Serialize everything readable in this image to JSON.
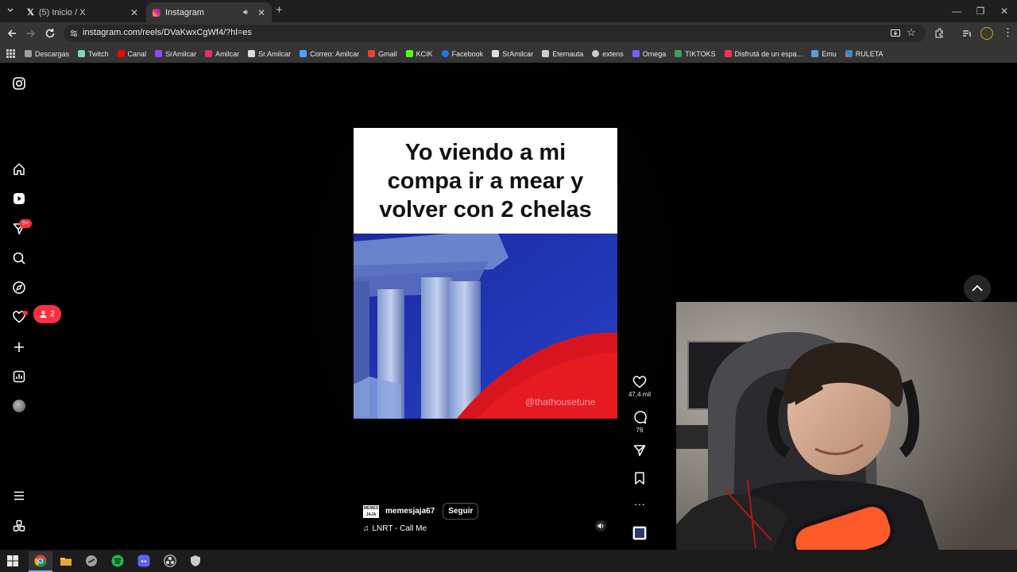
{
  "browser": {
    "tabs": [
      {
        "title": "(5) Inicio / X",
        "active": false,
        "icon": "x-logo-icon"
      },
      {
        "title": "Instagram",
        "active": true,
        "icon": "instagram-icon"
      }
    ],
    "url": "instagram.com/reels/DVaKwxCgWf4/?hl=es",
    "bookmarks": [
      {
        "label": "Descargas",
        "color": "#9aa0a6"
      },
      {
        "label": "Twitch",
        "color": "#7dd3c0"
      },
      {
        "label": "Canal",
        "color": "#ff0000"
      },
      {
        "label": "SrAmilcar",
        "color": "#9146ff"
      },
      {
        "label": "Amilcar",
        "color": "#e1306c"
      },
      {
        "label": "Sr.Amilcar",
        "color": "#dddddd"
      },
      {
        "label": "Correo: Amilcar",
        "color": "#4aa3ff"
      },
      {
        "label": "Gmail",
        "color": "#ea4335"
      },
      {
        "label": "KCIK",
        "color": "#53fc18"
      },
      {
        "label": "Facebook",
        "color": "#1877f2"
      },
      {
        "label": "SrAmilcar",
        "color": "#dddddd"
      },
      {
        "label": "Eternauta",
        "color": "#cccccc"
      },
      {
        "label": "extens",
        "color": "#cccccc"
      },
      {
        "label": "Omega",
        "color": "#7b5cff"
      },
      {
        "label": "TIKTOKS",
        "color": "#34a853"
      },
      {
        "label": "Disfrutá de un espa...",
        "color": "#ff2d55"
      },
      {
        "label": "Emu",
        "color": "#5aa0d8"
      },
      {
        "label": "RULETA",
        "color": "#ff7a00"
      }
    ]
  },
  "sidebar": {
    "notifications_badge": "9+",
    "new_followers": "2"
  },
  "reel": {
    "caption": "Yo viendo a mi compa ir a mear y volver con 2 chelas",
    "watermark": "@thathousetune",
    "author": "memesjaja67",
    "author_logo": "MEMES JAJA",
    "follow_label": "Seguir",
    "audio": "LNRT - Call Me",
    "likes": "47,4 mil",
    "comments": "76"
  },
  "colors": {
    "accent_red": "#ff3040",
    "caption_bg": "#ffffff",
    "page_bg": "#000000"
  }
}
